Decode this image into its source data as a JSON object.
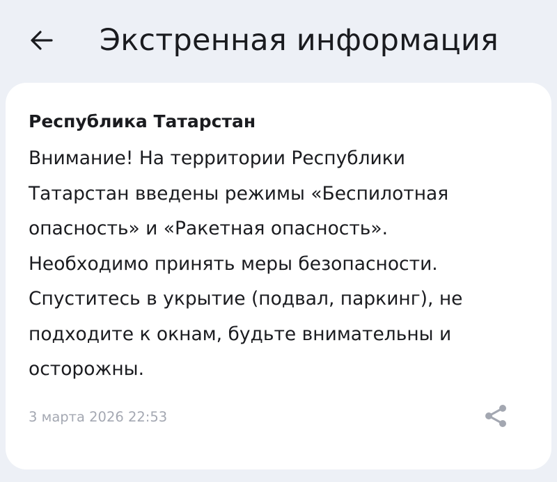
{
  "header": {
    "back_icon": "arrow-left-icon",
    "title": "Экстренная информация"
  },
  "alert": {
    "title": "Республика Татарстан",
    "body": "Внимание! На территории Республики\nТатарстан введены режимы «Беспилотная\nопасность» и «Ракетная опасность».\nНеобходимо принять меры безопасности.\nСпуститесь в укрытие (подвал, паркинг), не\nподходите к окнам, будьте внимательны и\nосторожны.",
    "date": "3 марта 2026 22:53",
    "share_icon": "share-icon"
  },
  "colors": {
    "background": "#edf0f6",
    "card": "#ffffff",
    "text": "#1a1b1f",
    "muted": "#a4a8b2",
    "icon_muted": "#a3a7b1"
  }
}
